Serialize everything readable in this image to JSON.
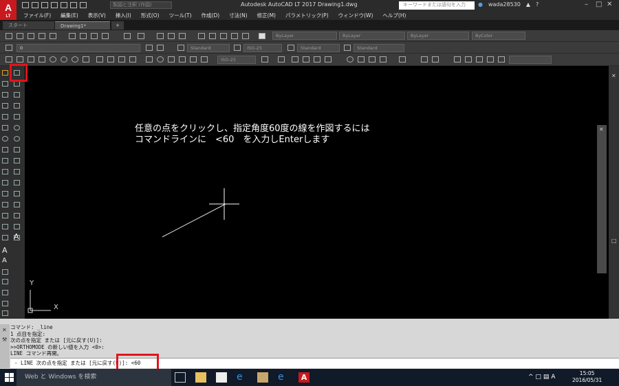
{
  "app": {
    "title": "Autodesk AutoCAD LT 2017    Drawing1.dwg",
    "logo": "A",
    "logo_sub": "LT",
    "workspace": "製図と注釈 (作図)",
    "search_placeholder": "キーワードまたは語句を入力",
    "user": "wada28530"
  },
  "menu": [
    "ファイル(F)",
    "編集(E)",
    "表示(V)",
    "挿入(I)",
    "形式(O)",
    "ツール(T)",
    "作成(D)",
    "寸法(N)",
    "修正(M)",
    "パラメトリック(P)",
    "ウィンドウ(W)",
    "ヘルプ(H)"
  ],
  "tabs": {
    "start": "スタート",
    "drawing": "Drawing1*",
    "add": "+"
  },
  "toolbar": {
    "layer": "ByLayer",
    "linetype": "ByLayer",
    "lineweight": "ByLayer",
    "color": "ByColor",
    "layer_name": "0",
    "text_style": "Standard",
    "dim_style": "ISO-25",
    "table_style": "Standard",
    "multileader_style": "Standard",
    "dim_style2": "ISO-25"
  },
  "overlay": {
    "line1": "任意の点をクリックし、指定角度60度の線を作図するには",
    "line2": "コマンドラインに　<60　を入力しEnterします"
  },
  "ucs": {
    "x": "X",
    "y": "Y"
  },
  "command": {
    "history": [
      "コマンド: _line",
      "1 点目を指定:",
      "次の点を指定 または [元に戻す(U)]:",
      ">>ORTHOMODE の新しい値を入力 <0>:",
      "LINE コマンド再開。"
    ],
    "current": "- LINE 次の点を指定 または [元に戻す(U)]:  <60"
  },
  "taskbar": {
    "search": "Web と Windows を検索",
    "time": "15:05",
    "date": "2016/05/31",
    "ime": "A"
  }
}
